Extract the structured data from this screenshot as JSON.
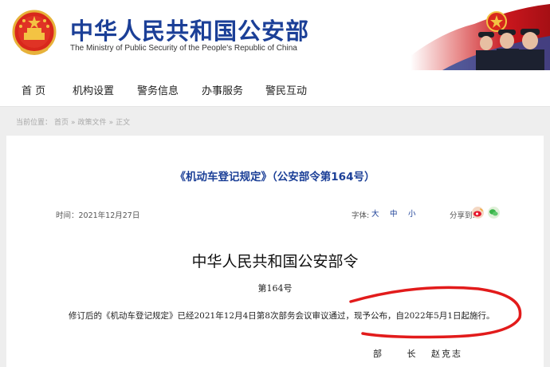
{
  "header": {
    "title_cn": "中华人民共和国公安部",
    "title_en": "The Ministry of Public Security of the People's Republic of China",
    "brand_color": "#1b3f97",
    "banner_color": "#c8161d"
  },
  "nav": {
    "items": [
      "首 页",
      "机构设置",
      "警务信息",
      "办事服务",
      "警民互动"
    ]
  },
  "breadcrumb": {
    "items": [
      "当前位置：",
      "首页",
      "»",
      "政策文件",
      "»",
      "正文"
    ]
  },
  "article": {
    "title": "《机动车登记规定》（公安部令第164号）",
    "date_label": "时间：2021年12月27日",
    "font_size_label": "字体:",
    "font_sizes": [
      "大",
      "中",
      "小"
    ],
    "share_label": "分享到:",
    "share_icons": [
      "weibo-icon",
      "wechat-icon"
    ],
    "heading": "中华人民共和国公安部令",
    "number": "第164号",
    "body": "修订后的《机动车登记规定》已经2021年12月4日第8次部务会议审议通过，现予公布，自2022年5月1日起施行。",
    "sign_title": "部 长",
    "sign_name": "赵克志"
  },
  "annotation": {
    "color": "#e21b1b"
  }
}
